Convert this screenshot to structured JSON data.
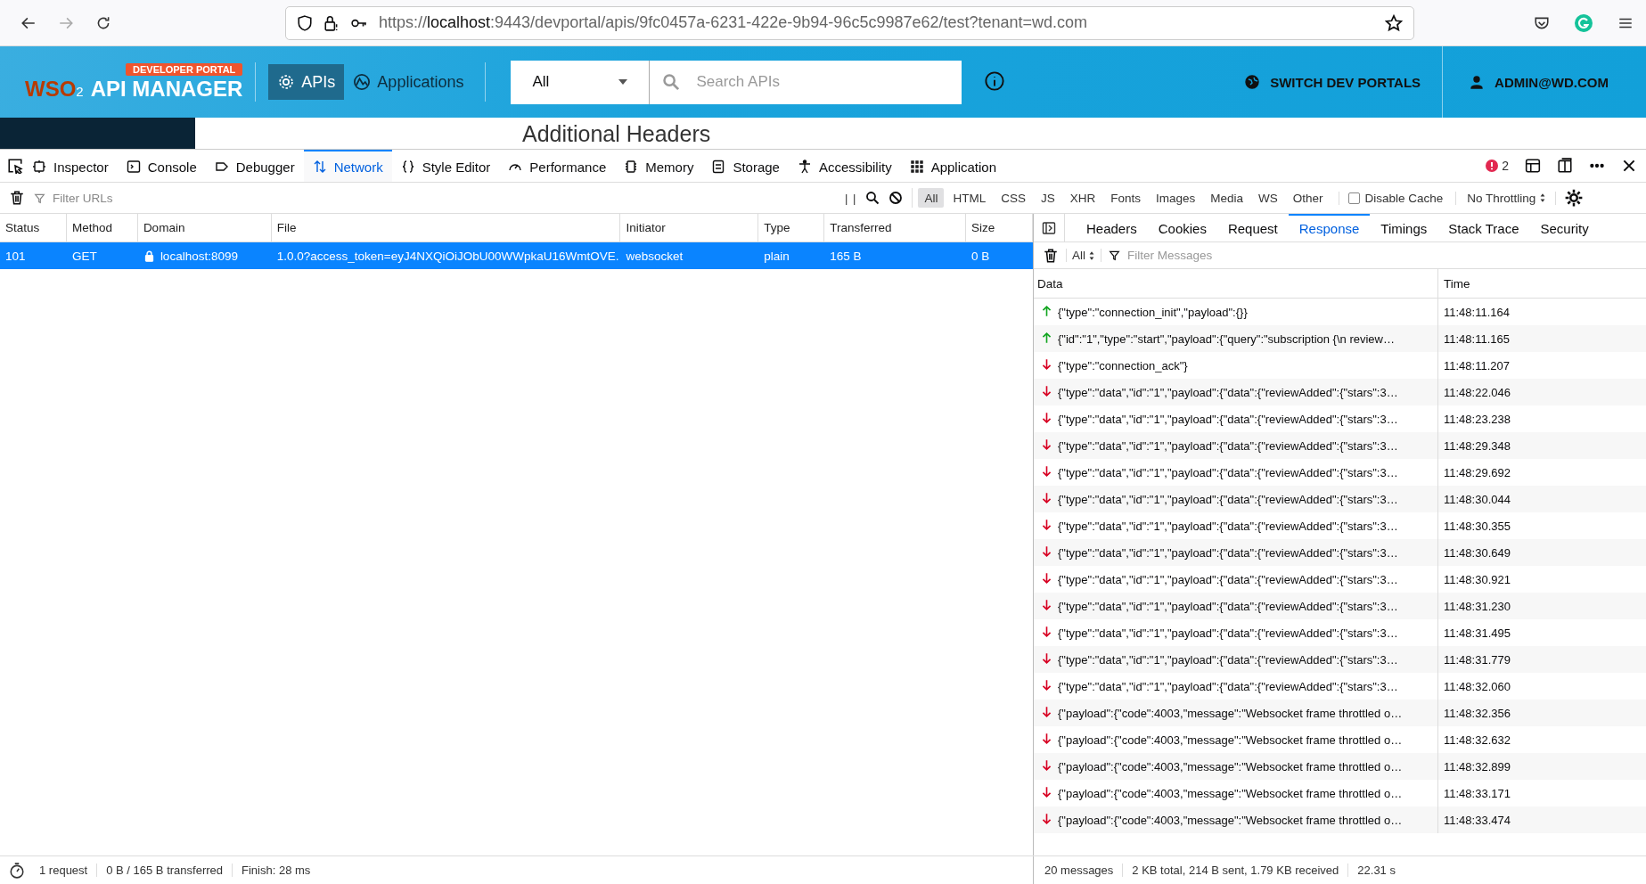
{
  "browser": {
    "url_scheme": "https://",
    "url_host": "localhost",
    "url_rest": ":9443/devportal/apis/9fc0457a-6231-422e-9b94-96c5c9987e62/test?tenant=wd.com"
  },
  "portal": {
    "badge": "DEVELOPER PORTAL",
    "logo_wso": "WSO",
    "logo_sub": "2",
    "logo_name": "API MANAGER",
    "nav": [
      {
        "label": "APIs",
        "selected": true
      },
      {
        "label": "Applications",
        "selected": false
      }
    ],
    "scope": "All",
    "search_placeholder": "Search APIs",
    "switch": "SWITCH DEV PORTALS",
    "user": "ADMIN@WD.COM",
    "page_heading": "Additional Headers"
  },
  "devtools": {
    "tabs": [
      {
        "label": "Inspector",
        "selected": false
      },
      {
        "label": "Console",
        "selected": false
      },
      {
        "label": "Debugger",
        "selected": false
      },
      {
        "label": "Network",
        "selected": true
      },
      {
        "label": "Style Editor",
        "selected": false
      },
      {
        "label": "Performance",
        "selected": false
      },
      {
        "label": "Memory",
        "selected": false
      },
      {
        "label": "Storage",
        "selected": false
      },
      {
        "label": "Accessibility",
        "selected": false
      },
      {
        "label": "Application",
        "selected": false
      }
    ],
    "error_count": "2"
  },
  "filter": {
    "placeholder": "Filter URLs",
    "pause": "| |",
    "types": [
      {
        "label": "All",
        "selected": true
      },
      {
        "label": "HTML",
        "selected": false
      },
      {
        "label": "CSS",
        "selected": false
      },
      {
        "label": "JS",
        "selected": false
      },
      {
        "label": "XHR",
        "selected": false
      },
      {
        "label": "Fonts",
        "selected": false
      },
      {
        "label": "Images",
        "selected": false
      },
      {
        "label": "Media",
        "selected": false
      },
      {
        "label": "WS",
        "selected": false
      },
      {
        "label": "Other",
        "selected": false
      }
    ],
    "disable_cache": {
      "label": "Disable Cache",
      "checked": false
    },
    "throttling": "No Throttling"
  },
  "table": {
    "columns": [
      "Status",
      "Method",
      "Domain",
      "File",
      "Initiator",
      "Type",
      "Transferred",
      "Size"
    ],
    "rows": [
      {
        "selected": true,
        "cells": [
          "101",
          "GET",
          "localhost:8099",
          "1.0.0?access_token=eyJ4NXQiOiJObU00WWpkaU16WmtOVE.",
          "websocket",
          "plain",
          "165 B",
          "0 B"
        ]
      }
    ]
  },
  "details": {
    "tabs": [
      {
        "label": "Headers",
        "selected": false
      },
      {
        "label": "Cookies",
        "selected": false
      },
      {
        "label": "Request",
        "selected": false
      },
      {
        "label": "Response",
        "selected": true
      },
      {
        "label": "Timings",
        "selected": false
      },
      {
        "label": "Stack Trace",
        "selected": false
      },
      {
        "label": "Security",
        "selected": false
      }
    ],
    "message_filter": "All",
    "filter_placeholder": "Filter Messages",
    "columns": [
      "Data",
      "Time"
    ],
    "messages": [
      {
        "kind": "sent",
        "data": "{\"type\":\"connection_init\",\"payload\":{}}",
        "time": "11:48:11.164"
      },
      {
        "kind": "sent",
        "data": "{\"id\":\"1\",\"type\":\"start\",\"payload\":{\"query\":\"subscription {\\n review…",
        "time": "11:48:11.165"
      },
      {
        "kind": "received",
        "data": "{\"type\":\"connection_ack\"}",
        "time": "11:48:11.207"
      },
      {
        "kind": "received",
        "data": "{\"type\":\"data\",\"id\":\"1\",\"payload\":{\"data\":{\"reviewAdded\":{\"stars\":3…",
        "time": "11:48:22.046"
      },
      {
        "kind": "received",
        "data": "{\"type\":\"data\",\"id\":\"1\",\"payload\":{\"data\":{\"reviewAdded\":{\"stars\":3…",
        "time": "11:48:23.238"
      },
      {
        "kind": "received",
        "data": "{\"type\":\"data\",\"id\":\"1\",\"payload\":{\"data\":{\"reviewAdded\":{\"stars\":3…",
        "time": "11:48:29.348"
      },
      {
        "kind": "received",
        "data": "{\"type\":\"data\",\"id\":\"1\",\"payload\":{\"data\":{\"reviewAdded\":{\"stars\":3…",
        "time": "11:48:29.692"
      },
      {
        "kind": "received",
        "data": "{\"type\":\"data\",\"id\":\"1\",\"payload\":{\"data\":{\"reviewAdded\":{\"stars\":3…",
        "time": "11:48:30.044"
      },
      {
        "kind": "received",
        "data": "{\"type\":\"data\",\"id\":\"1\",\"payload\":{\"data\":{\"reviewAdded\":{\"stars\":3…",
        "time": "11:48:30.355"
      },
      {
        "kind": "received",
        "data": "{\"type\":\"data\",\"id\":\"1\",\"payload\":{\"data\":{\"reviewAdded\":{\"stars\":3…",
        "time": "11:48:30.649"
      },
      {
        "kind": "received",
        "data": "{\"type\":\"data\",\"id\":\"1\",\"payload\":{\"data\":{\"reviewAdded\":{\"stars\":3…",
        "time": "11:48:30.921"
      },
      {
        "kind": "received",
        "data": "{\"type\":\"data\",\"id\":\"1\",\"payload\":{\"data\":{\"reviewAdded\":{\"stars\":3…",
        "time": "11:48:31.230"
      },
      {
        "kind": "received",
        "data": "{\"type\":\"data\",\"id\":\"1\",\"payload\":{\"data\":{\"reviewAdded\":{\"stars\":3…",
        "time": "11:48:31.495"
      },
      {
        "kind": "received",
        "data": "{\"type\":\"data\",\"id\":\"1\",\"payload\":{\"data\":{\"reviewAdded\":{\"stars\":3…",
        "time": "11:48:31.779"
      },
      {
        "kind": "received",
        "data": "{\"type\":\"data\",\"id\":\"1\",\"payload\":{\"data\":{\"reviewAdded\":{\"stars\":3…",
        "time": "11:48:32.060"
      },
      {
        "kind": "received",
        "data": "{\"payload\":{\"code\":4003,\"message\":\"Websocket frame throttled o…",
        "time": "11:48:32.356"
      },
      {
        "kind": "received",
        "data": "{\"payload\":{\"code\":4003,\"message\":\"Websocket frame throttled o…",
        "time": "11:48:32.632"
      },
      {
        "kind": "received",
        "data": "{\"payload\":{\"code\":4003,\"message\":\"Websocket frame throttled o…",
        "time": "11:48:32.899"
      },
      {
        "kind": "received",
        "data": "{\"payload\":{\"code\":4003,\"message\":\"Websocket frame throttled o…",
        "time": "11:48:33.171"
      },
      {
        "kind": "received",
        "data": "{\"payload\":{\"code\":4003,\"message\":\"Websocket frame throttled o…",
        "time": "11:48:33.474"
      }
    ]
  },
  "status_left": [
    "1 request",
    "0 B / 165 B transferred",
    "Finish: 28 ms"
  ],
  "status_right": [
    "20 messages",
    "2 KB total, 214 B sent, 1.79 KB received",
    "22.31 s"
  ]
}
